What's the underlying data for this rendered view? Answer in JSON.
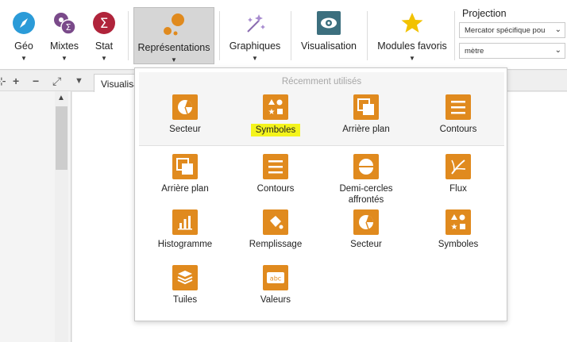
{
  "ribbon": {
    "buttons": [
      {
        "label": "Géo"
      },
      {
        "label": "Mixtes"
      },
      {
        "label": "Stat"
      },
      {
        "label": "Représentations"
      },
      {
        "label": "Graphiques"
      },
      {
        "label": "Visualisation"
      },
      {
        "label": "Modules favoris"
      }
    ],
    "projection": {
      "title": "Projection",
      "projection_value": "Mercator spécifique pou",
      "unit_value": "mètre"
    }
  },
  "workspace": {
    "tab_label": "Visualisa"
  },
  "dropdown": {
    "recent_title": "Récemment utilisés",
    "recent_items": [
      {
        "label": "Secteur",
        "icon": "pie-icon"
      },
      {
        "label": "Symboles",
        "icon": "symbols-icon"
      },
      {
        "label": "Arrière plan",
        "icon": "background-icon"
      },
      {
        "label": "Contours",
        "icon": "contours-icon"
      }
    ],
    "all_items": [
      {
        "label": "Arrière plan",
        "icon": "background-icon"
      },
      {
        "label": "Contours",
        "icon": "contours-icon"
      },
      {
        "label": "Demi-cercles affrontés",
        "icon": "half-circles-icon"
      },
      {
        "label": "Flux",
        "icon": "flux-icon"
      },
      {
        "label": "Histogramme",
        "icon": "histogram-icon"
      },
      {
        "label": "Remplissage",
        "icon": "fill-icon"
      },
      {
        "label": "Secteur",
        "icon": "pie-icon"
      },
      {
        "label": "Symboles",
        "icon": "symbols-icon"
      },
      {
        "label": "Tuiles",
        "icon": "tiles-icon"
      },
      {
        "label": "Valeurs",
        "icon": "values-icon"
      }
    ]
  },
  "colors": {
    "accent_orange": "#e08a1e",
    "highlight_yellow": "#f4f41c",
    "geo_blue": "#2b9bd8",
    "mixtes_purple": "#7a4a8a",
    "stat_red": "#b0243b",
    "visualisation_teal": "#3c6f7e",
    "favoris_yellow": "#f2c200"
  }
}
